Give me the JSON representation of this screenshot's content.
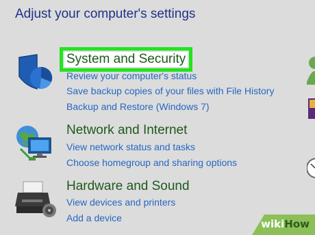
{
  "page": {
    "title": "Adjust your computer's settings"
  },
  "categories": [
    {
      "title": "System and Security",
      "icon": "shield-icon",
      "links": [
        "Review your computer's status",
        "Save backup copies of your files with File History",
        "Backup and Restore (Windows 7)"
      ]
    },
    {
      "title": "Network and Internet",
      "icon": "network-icon",
      "links": [
        "View network status and tasks",
        "Choose homegroup and sharing options"
      ]
    },
    {
      "title": "Hardware and Sound",
      "icon": "printer-icon",
      "links": [
        "View devices and printers",
        "Add a device"
      ]
    }
  ],
  "watermark": {
    "wiki": "wiki",
    "how": "How"
  },
  "colors": {
    "highlight": "#22e41e",
    "link": "#2667c2",
    "category_title": "#1c5a1c",
    "page_title": "#1e3287"
  }
}
